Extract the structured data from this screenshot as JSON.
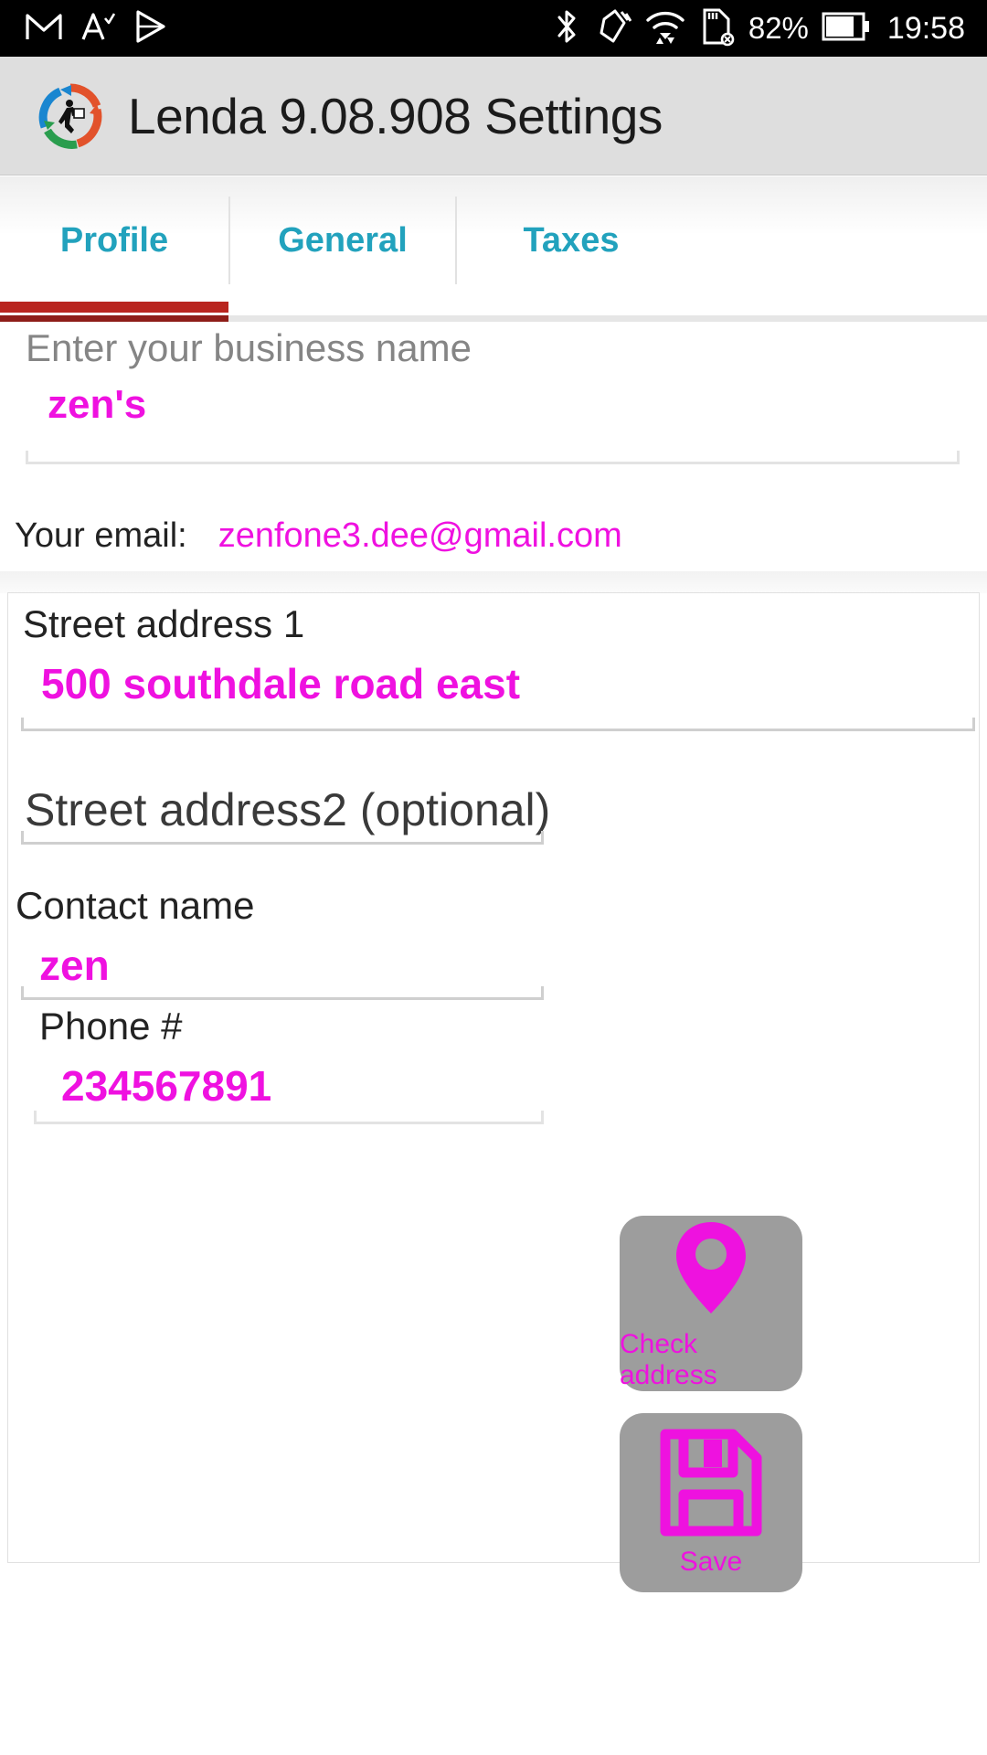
{
  "status_bar": {
    "time": "19:58",
    "battery_percent": "82%",
    "icons": [
      "gmail-icon",
      "font-size-icon",
      "play-store-icon",
      "bluetooth-icon",
      "vibrate-icon",
      "wifi-icon",
      "sd-card-removed-icon",
      "battery-icon"
    ]
  },
  "app_bar": {
    "title": "Lenda 9.08.908 Settings",
    "logo": "lenda-circular-runner-logo",
    "background": "#dedede"
  },
  "tabs": {
    "active_index": 0,
    "accent_color": "#22a2bd",
    "indicator_color": "#b9251f",
    "items": [
      {
        "label": "Profile"
      },
      {
        "label": "General"
      },
      {
        "label": "Taxes"
      }
    ]
  },
  "form": {
    "value_color": "#ef11e0",
    "business_name": {
      "placeholder": "Enter your business name",
      "value": "zen's"
    },
    "email": {
      "label": "Your email:",
      "value": "zenfone3.dee@gmail.com"
    },
    "street_address_1": {
      "label": "Street address 1",
      "value": "500 southdale road east"
    },
    "street_address_2": {
      "placeholder": "Street address2 (optional)",
      "value": ""
    },
    "contact_name": {
      "label": "Contact name",
      "value": "zen"
    },
    "phone": {
      "label": "Phone #",
      "value": "234567891"
    }
  },
  "actions": {
    "check_address": {
      "label": "Check address",
      "icon": "map-pin-icon",
      "background": "#9d9d9d"
    },
    "save": {
      "label": "Save",
      "icon": "floppy-disk-icon",
      "background": "#9d9d9d"
    }
  }
}
